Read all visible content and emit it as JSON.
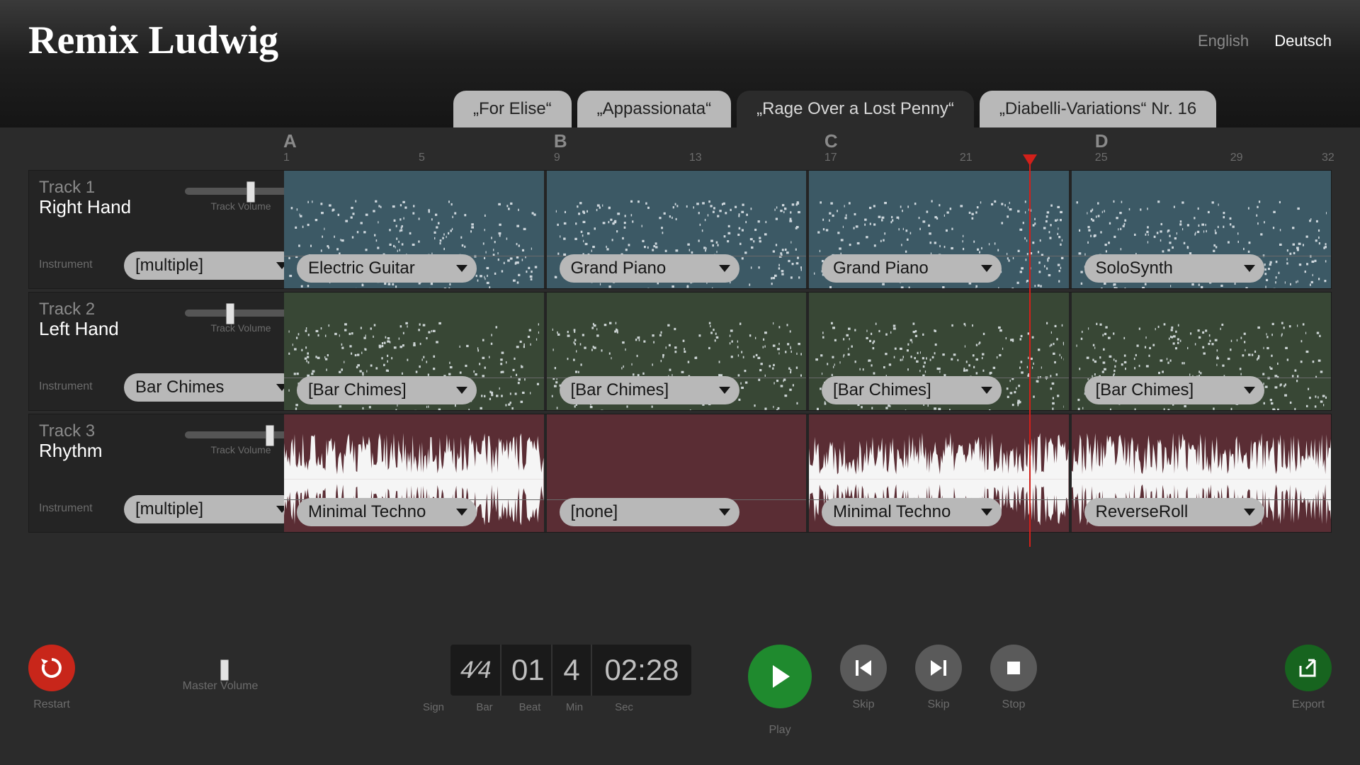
{
  "app": {
    "title": "Remix Ludwig"
  },
  "lang": {
    "en": "English",
    "de": "Deutsch",
    "active": "de"
  },
  "songs": [
    {
      "label": "„For Elise“",
      "selected": false
    },
    {
      "label": "„Appassionata“",
      "selected": false
    },
    {
      "label": "„Rage Over a Lost Penny“",
      "selected": true
    },
    {
      "label": "„Diabelli-Variations“ Nr. 16",
      "selected": false
    }
  ],
  "timeline": {
    "sections": [
      {
        "label": "A",
        "bar": 1
      },
      {
        "label": "B",
        "bar": 9
      },
      {
        "label": "C",
        "bar": 17
      },
      {
        "label": "D",
        "bar": 25
      }
    ],
    "bar_ticks": [
      1,
      5,
      9,
      13,
      17,
      21,
      25,
      29,
      32
    ],
    "total_bars": 32,
    "playhead_bar": 23.9
  },
  "tracks": [
    {
      "num": "Track 1",
      "name": "Right Hand",
      "volume_label": "Track Volume",
      "volume": 0.55,
      "instrument_label": "Instrument",
      "master_instrument": "[multiple]",
      "color": "t1",
      "viz": "midi",
      "clips": [
        {
          "instrument": "Electric Guitar"
        },
        {
          "instrument": "Grand Piano"
        },
        {
          "instrument": "Grand Piano"
        },
        {
          "instrument": "SoloSynth"
        }
      ]
    },
    {
      "num": "Track 2",
      "name": "Left Hand",
      "volume_label": "Track Volume",
      "volume": 0.37,
      "instrument_label": "Instrument",
      "master_instrument": "Bar Chimes",
      "color": "t2",
      "viz": "midi",
      "clips": [
        {
          "instrument": "[Bar Chimes]"
        },
        {
          "instrument": "[Bar Chimes]"
        },
        {
          "instrument": "[Bar Chimes]"
        },
        {
          "instrument": "[Bar Chimes]"
        }
      ]
    },
    {
      "num": "Track 3",
      "name": "Rhythm",
      "volume_label": "Track Volume",
      "volume": 0.72,
      "instrument_label": "Instrument",
      "master_instrument": "[multiple]",
      "color": "t3",
      "viz": "wave",
      "clips": [
        {
          "instrument": "Minimal Techno"
        },
        {
          "instrument": "[none]",
          "empty": true
        },
        {
          "instrument": "Minimal Techno"
        },
        {
          "instrument": "ReverseRoll"
        }
      ]
    }
  ],
  "transport": {
    "restart": "Restart",
    "master_volume_label": "Master Volume",
    "master_volume": 0.74,
    "sign_num": "4",
    "sign_den": "4",
    "bar": "01",
    "beat": "4",
    "min": "02",
    "sec": "28",
    "cap_sign": "Sign",
    "cap_bar": "Bar",
    "cap_beat": "Beat",
    "cap_min": "Min",
    "cap_sec": "Sec",
    "play": "Play",
    "skip": "Skip",
    "stop": "Stop",
    "export": "Export"
  }
}
